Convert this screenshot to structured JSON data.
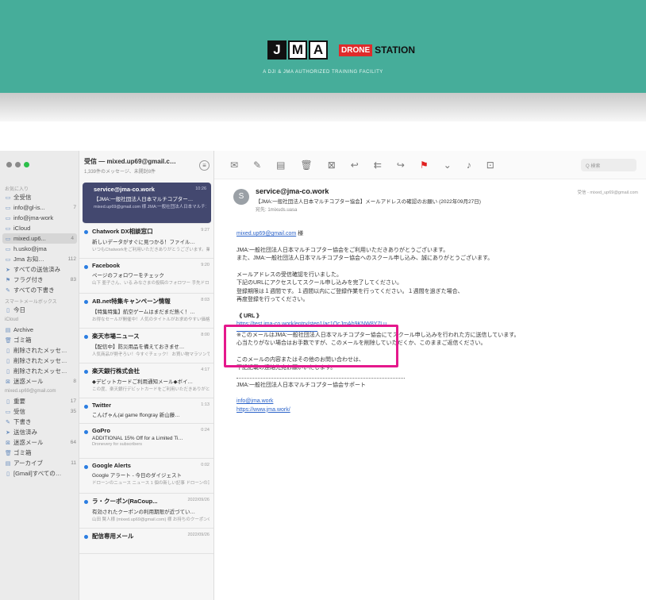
{
  "banner": {
    "jma_letters": [
      "J",
      "M",
      "A"
    ],
    "drone_red": "DRONE",
    "drone_text": "STATION",
    "subtitle": "A DJI & JMA AUTHORIZED TRAINING FACILITY",
    "color": "#46ad9a"
  },
  "sidebar": {
    "section_mailboxes": "お気に入り",
    "items": [
      {
        "label": "全受信",
        "count": "",
        "icon": "inbox-icon"
      },
      {
        "label": "info@gl-is...",
        "count": "7",
        "icon": "inbox-icon"
      },
      {
        "label": "info@jma-work",
        "count": "",
        "icon": "inbox-icon"
      },
      {
        "label": "iCloud",
        "count": "",
        "icon": "inbox-icon"
      },
      {
        "label": "mixed.up6...",
        "count": "4",
        "icon": "inbox-icon",
        "selected": true
      },
      {
        "label": "h.usko@jma",
        "count": "",
        "icon": "inbox-icon"
      },
      {
        "label": "Jma お知…",
        "count": "112",
        "icon": "inbox-icon"
      },
      {
        "label": "すべての送信済み",
        "count": "",
        "icon": "sent-icon"
      },
      {
        "label": "フラグ付き",
        "count": "83",
        "icon": "flag-icon"
      },
      {
        "label": "すべての下書き",
        "count": "",
        "icon": "draft-icon"
      }
    ],
    "section_smart": "スマートメールボックス",
    "items2": [
      {
        "label": "今日",
        "count": "",
        "icon": "folder-icon"
      }
    ],
    "section_account": "iCloud",
    "items3": [
      {
        "label": "Archive",
        "count": "",
        "icon": "archive-icon"
      },
      {
        "label": "ゴミ箱",
        "count": "",
        "icon": "trash-icon"
      },
      {
        "label": "削除されたメッセ…",
        "count": "",
        "icon": "folder-icon"
      },
      {
        "label": "削除されたメッセ…",
        "count": "",
        "icon": "folder-icon"
      },
      {
        "label": "削除されたメッセ…",
        "count": "",
        "icon": "folder-icon"
      },
      {
        "label": "迷惑メール",
        "count": "8",
        "icon": "junk-icon"
      }
    ],
    "section_gmail": "mixed.up69@gmail.com",
    "items4": [
      {
        "label": "重要",
        "count": "17",
        "icon": "folder-icon"
      },
      {
        "label": "受信",
        "count": "35",
        "icon": "inbox-icon"
      },
      {
        "label": "下書き",
        "count": "",
        "icon": "draft-icon"
      },
      {
        "label": "送信済み",
        "count": "",
        "icon": "sent-icon"
      },
      {
        "label": "迷惑メール",
        "count": "64",
        "icon": "junk-icon"
      },
      {
        "label": "ゴミ箱",
        "count": "",
        "icon": "trash-icon"
      },
      {
        "label": "アーカイブ",
        "count": "11",
        "icon": "archive-icon"
      },
      {
        "label": "[Gmail]すべての…",
        "count": "",
        "icon": "folder-icon"
      }
    ]
  },
  "list": {
    "title": "受信 — mixed.up69@gmail.c…",
    "subtitle": "1,339件のメッセージ、未開封8件",
    "items": [
      {
        "from": "service@jma-co.work",
        "time": "10:26",
        "subject": "【JMA:一般社団法人日本マルチコプター…",
        "preview": "mixed.up69@gmail.com 様 JMA:一般社団法人日本マルチコプター協会をご利用いただき…",
        "selected": true
      },
      {
        "from": "Chatwork DX相談窓口",
        "time": "9:27",
        "subject": "新しいデータがすぐに見つかる！ファイル…",
        "preview": "いつもChatworkをご利用いただきありがとうございます。業務のデジタル化を…",
        "selected": false
      },
      {
        "from": "Facebook",
        "time": "9:20",
        "subject": "ページのフォロワーをチェック",
        "preview": "山下 亜子さん、いる.みなさまの投稿のフォロワー 手先ドローンのTikTok Comic どうなってるか…",
        "selected": false
      },
      {
        "from": "AB.net特集キャンペーン情報",
        "time": "8:03",
        "subject": "【特集特集】航空ゲームはまだまだ熱く！…",
        "preview": "お得なセールが開催中！人気のタイトルがお求めやすい価格でお楽しみいただけます…",
        "selected": false
      },
      {
        "from": "楽天市場ニュース",
        "time": "8:00",
        "subject": "【配信中】防災用品を備えておきませ…",
        "preview": "人気商品が勢ぞろい！今すぐチェック！ お買い物マラソンで楽しくお得にお買い物…",
        "selected": false
      },
      {
        "from": "楽天銀行株式会社",
        "time": "4:17",
        "subject": "◆デビットカードご利用通知メール◆ボイ…",
        "preview": "この度、楽天銀行デビットカードをご利用いただきありがとうございます。ご利用内容…",
        "selected": false
      },
      {
        "from": "Twitter",
        "time": "1:13",
        "subject": "こんげゃん(al game ffongray 新山藤…",
        "preview": "",
        "selected": false
      },
      {
        "from": "GoPro",
        "time": "0:24",
        "subject": "ADDITIONAL 15% Off for a Limited Ti…",
        "preview": "Dronevery for subscribers",
        "selected": false
      },
      {
        "from": "Google Alerts",
        "time": "0:02",
        "subject": "Google アラート - 今日のダイジェスト",
        "preview": "ドローンのニュース ニュース 1 個の新しい記事 ドローンの活用が広がる中…",
        "selected": false
      },
      {
        "from": "ラ・クーポン(RaCoup...",
        "time": "2022/09/26",
        "subject": "有効されたクーポンの利用期限が近づてい…",
        "preview": "山田 賢人様 (mixed.up69@gmail.com) 様 お持ちのクーポンの有効期限が近づいています…",
        "selected": false
      },
      {
        "from": "配信専用メール",
        "time": "2022/09/26",
        "subject": "",
        "preview": "",
        "selected": false
      }
    ]
  },
  "toolbar": {
    "icons": [
      "envelope-icon",
      "compose-icon",
      "archive-icon",
      "trash-icon",
      "junk-icon",
      "reply-icon",
      "reply-all-icon",
      "forward-icon",
      "flag-icon",
      "chevron-down-icon",
      "mute-icon",
      "move-icon"
    ],
    "glyphs": [
      "✉",
      "✎",
      "▤",
      "🗑",
      "⊠",
      "↩",
      "⇇",
      "↪",
      "⚑",
      "⌄",
      "♪",
      "⊡"
    ],
    "search_placeholder": "Q 検索"
  },
  "message": {
    "avatar": "S",
    "from": "service@jma-co.work",
    "subject": "【JMA:一般社団法人日本マルチコプター協会】メールアドレスの確認のお願い (2022年09月27日)",
    "to": "宛先: mixed.up69@gmail.com",
    "to_short": "宛先: 1mixuds.uasa",
    "date_right": "受信 ‐ mixed_up69@gmail.com",
    "greeting_link": "mixed.up69@gmail.com",
    "greeting_suffix": " 様",
    "lines1": [
      "JMA:一般社団法人日本マルチコプター協会をご利用いただきありがとうございます。",
      "また、JMA:一般社団法人日本マルチコプター協会へのスクール申し込み、誠にありがとうございます。"
    ],
    "lines2": [
      "メールアドレスの受信確認を行いました。",
      "下記のURLにアクセスしてスクール申し込みを完了してください。",
      "登録期限は１週間です。１週間以内にご登録作業を行ってください。１週間を過ぎた場合、",
      "再度登録を行ってください。"
    ],
    "url_label": "《 URL 》",
    "url": "https://test.jma-co.work/entry/step1/ac1OcJmAh9KNW8Y7Lu",
    "lines3": [
      "※このメールはJMA:一般社団法人日本マルチコプター協会にてスクール申し込みを行われた方に送信しています。",
      "心当たりがない場合はお手数ですが、このメールを削除していただくか、このままご返信ください。"
    ],
    "lines4": [
      "このメールの内容またはその他のお問い合わせは、",
      "下記記載の連絡先宛お願いいたします。"
    ],
    "signature": "JMA:一般社団法人日本マルチコプター協会サポート",
    "sig_link1": "info@jma.work",
    "sig_link2": "https://www.jma.work/"
  }
}
